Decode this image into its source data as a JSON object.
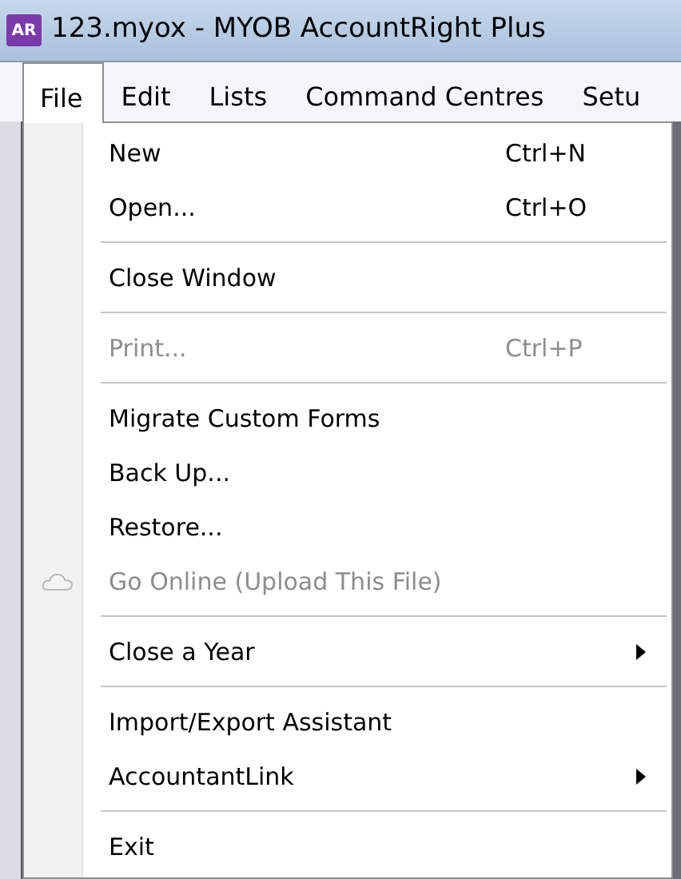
{
  "window": {
    "app_badge": "AR",
    "title": "123.myox - MYOB AccountRight Plus"
  },
  "menu_bar": [
    {
      "label": "File",
      "selected": true
    },
    {
      "label": "Edit",
      "selected": false
    },
    {
      "label": "Lists",
      "selected": false
    },
    {
      "label": "Command Centres",
      "selected": false
    },
    {
      "label": "Setu",
      "selected": false
    }
  ],
  "file_menu": [
    {
      "kind": "item",
      "label": "New",
      "shortcut": "Ctrl+N",
      "disabled": false,
      "submenu": false
    },
    {
      "kind": "item",
      "label": "Open...",
      "shortcut": "Ctrl+O",
      "disabled": false,
      "submenu": false
    },
    {
      "kind": "separator"
    },
    {
      "kind": "item",
      "label": "Close Window",
      "disabled": false,
      "submenu": false
    },
    {
      "kind": "separator"
    },
    {
      "kind": "item",
      "label": "Print...",
      "shortcut": "Ctrl+P",
      "disabled": true,
      "submenu": false
    },
    {
      "kind": "separator"
    },
    {
      "kind": "item",
      "label": "Migrate Custom Forms",
      "disabled": false,
      "submenu": false
    },
    {
      "kind": "item",
      "label": "Back Up...",
      "disabled": false,
      "submenu": false
    },
    {
      "kind": "item",
      "label": "Restore...",
      "disabled": false,
      "submenu": false
    },
    {
      "kind": "icon-item",
      "label": "Go Online (Upload This File)",
      "disabled": true,
      "submenu": false
    },
    {
      "kind": "separator"
    },
    {
      "kind": "item",
      "label": "Close a Year",
      "disabled": false,
      "submenu": true
    },
    {
      "kind": "separator"
    },
    {
      "kind": "item",
      "label": "Import/Export Assistant",
      "disabled": false,
      "submenu": false
    },
    {
      "kind": "item",
      "label": "AccountantLink",
      "disabled": false,
      "submenu": true
    },
    {
      "kind": "separator"
    },
    {
      "kind": "item",
      "label": "Exit",
      "disabled": false,
      "submenu": false
    }
  ]
}
